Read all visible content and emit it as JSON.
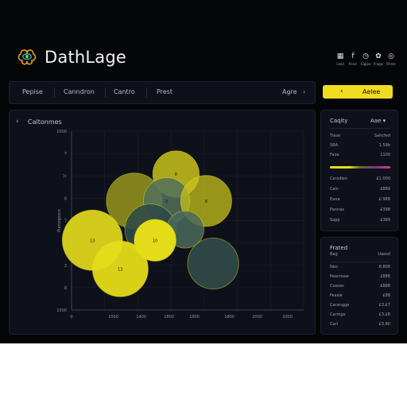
{
  "app": {
    "title": "DathLage"
  },
  "top_icons": [
    {
      "icon": "grid-icon",
      "glyph": "▦",
      "label": "Lasd"
    },
    {
      "icon": "facebook-icon",
      "glyph": "f",
      "label": "Rrsst"
    },
    {
      "icon": "clock-icon",
      "glyph": "◷",
      "label": "Gigipe"
    },
    {
      "icon": "settings-icon",
      "glyph": "✿",
      "label": "Fnage"
    },
    {
      "icon": "user-icon",
      "glyph": "◎",
      "label": "Rhnle"
    }
  ],
  "nav": {
    "items": [
      "Pepise",
      "Canndron",
      "Cantro",
      "Prest"
    ],
    "right_label": "Agre",
    "right_arrow": "›"
  },
  "yellow_button": {
    "chevron": "‹",
    "label": "Aelee"
  },
  "chart_panel": {
    "back": "‹",
    "title": "Caltonmes"
  },
  "chart_data": {
    "type": "scatter",
    "ylabel": "Puoteqesco",
    "y_tick_labels": [
      "1000",
      "7",
      "7r",
      "8",
      "7",
      "5",
      "3",
      "8",
      "1000"
    ],
    "x_tick_labels": [
      "0",
      "1000",
      "1400",
      "1800",
      "1800",
      "1800",
      "2000",
      "2000"
    ],
    "bubbles": [
      {
        "x": 4.5,
        "y": 7.6,
        "r": 1.0,
        "color": "#c8c21c",
        "opacity": 0.85,
        "label": "8"
      },
      {
        "x": 2.7,
        "y": 6.1,
        "r": 1.2,
        "color": "#a09e1e",
        "opacity": 0.8,
        "label": ""
      },
      {
        "x": 4.1,
        "y": 6.1,
        "r": 1.0,
        "color": "#51705c",
        "opacity": 0.85,
        "label": "8"
      },
      {
        "x": 5.8,
        "y": 6.1,
        "r": 1.1,
        "color": "#c8c21c",
        "opacity": 0.75,
        "label": "8"
      },
      {
        "x": 3.4,
        "y": 4.5,
        "r": 1.1,
        "color": "#2f4a47",
        "opacity": 0.9,
        "label": "8"
      },
      {
        "x": 4.9,
        "y": 4.5,
        "r": 0.8,
        "color": "#4a6a5a",
        "opacity": 0.85,
        "label": ""
      },
      {
        "x": 0.9,
        "y": 3.9,
        "r": 1.3,
        "color": "#dcd51a",
        "opacity": 0.95,
        "label": "13"
      },
      {
        "x": 3.6,
        "y": 3.9,
        "r": 0.9,
        "color": "#e4dc18",
        "opacity": 1.0,
        "label": "10"
      },
      {
        "x": 2.1,
        "y": 2.3,
        "r": 1.2,
        "color": "#e4dc18",
        "opacity": 0.95,
        "label": "13"
      },
      {
        "x": 6.1,
        "y": 2.6,
        "r": 1.1,
        "color": "#2f4a47",
        "opacity": 0.95,
        "label": ""
      }
    ]
  },
  "side_panel_1": {
    "title": "Caqity",
    "title_right": "Aae",
    "rows_top": [
      {
        "k": "Tiase",
        "v": "Sahcfed"
      },
      {
        "k": "SBA",
        "v": "1.59b"
      },
      {
        "k": "Faoe",
        "v": "1100"
      }
    ],
    "rows_bottom": [
      {
        "k": "Cersdlen",
        "v": "£1.000"
      },
      {
        "k": "Cals",
        "v": "£889"
      },
      {
        "k": "Eana",
        "v": "£:988"
      },
      {
        "k": "Pannas",
        "v": "£398"
      },
      {
        "k": "Sapp",
        "v": "£389"
      }
    ]
  },
  "side_panel_2": {
    "title": "Frated",
    "col_k": "Bag",
    "col_v": "Uaesd",
    "rows": [
      {
        "k": "Neo",
        "v": "8.808"
      },
      {
        "k": "Peacnose",
        "v": "£888"
      },
      {
        "k": "Cosoes",
        "v": "£888"
      },
      {
        "k": "Feasle",
        "v": "£88"
      },
      {
        "k": "Carangge",
        "v": "£3.£7"
      },
      {
        "k": "Carmge",
        "v": "£3.£8"
      },
      {
        "k": "Carl",
        "v": "£3.80"
      }
    ]
  }
}
